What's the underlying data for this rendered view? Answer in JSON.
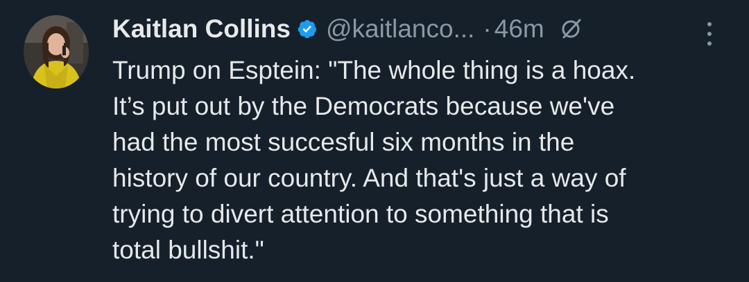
{
  "tweet": {
    "author_name": "Kaitlan Collins",
    "handle": "@kaitlanco...",
    "separator": "·",
    "time": "46m",
    "text": "Trump on Esptein: \"The whole thing is a hoax.\nIt’s put out by the Democrats because we've\nhad the most succesful six months in the\nhistory of our country. And that's just a way of\ntrying to divert attention to something that is\ntotal bullshit.\"",
    "verified": true
  },
  "icons": {
    "verified": "verified-badge-icon",
    "grok": "grok-icon",
    "more": "more-options-icon"
  },
  "colors": {
    "background": "#15202b",
    "text_primary": "#e7e9ea",
    "text_secondary": "#8b98a5",
    "verified_blue": "#1d9bf0"
  }
}
